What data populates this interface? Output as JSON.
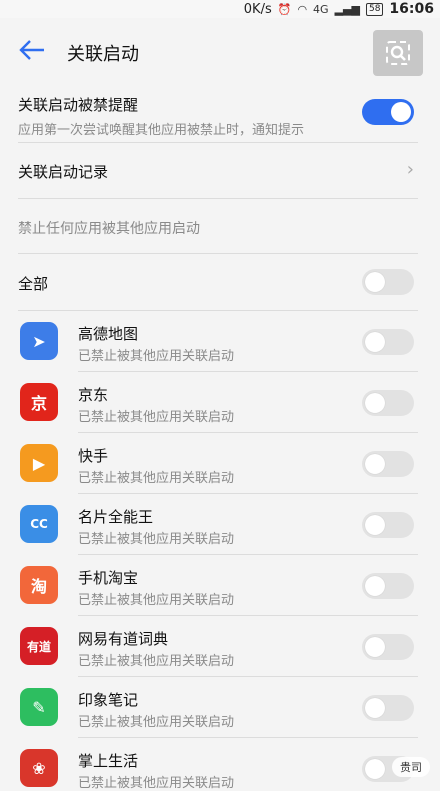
{
  "status": {
    "speed": "0K/s",
    "network": "4G",
    "battery": "58",
    "time": "16:06"
  },
  "header": {
    "title": "关联启动"
  },
  "notify": {
    "label": "关联启动被禁提醒",
    "sub": "应用第一次尝试唤醒其他应用被禁止时，通知提示",
    "on": true
  },
  "record": {
    "label": "关联启动记录"
  },
  "hint": {
    "text": "禁止任何应用被其他应用启动"
  },
  "all": {
    "label": "全部"
  },
  "apps": [
    {
      "name": "高德地图",
      "status": "已禁止被其他应用关联启动",
      "icon": "gaode-icon",
      "color": "#3d7de8",
      "glyph": "➤"
    },
    {
      "name": "京东",
      "status": "已禁止被其他应用关联启动",
      "icon": "jd-icon",
      "color": "#e1251b",
      "glyph": "京"
    },
    {
      "name": "快手",
      "status": "已禁止被其他应用关联启动",
      "icon": "kuaishou-icon",
      "color": "#f59a1f",
      "glyph": "▶"
    },
    {
      "name": "名片全能王",
      "status": "已禁止被其他应用关联启动",
      "icon": "camcard-icon",
      "color": "#3a8ee6",
      "glyph": "CC"
    },
    {
      "name": "手机淘宝",
      "status": "已禁止被其他应用关联启动",
      "icon": "taobao-icon",
      "color": "#f2673a",
      "glyph": "淘"
    },
    {
      "name": "网易有道词典",
      "status": "已禁止被其他应用关联启动",
      "icon": "youdao-icon",
      "color": "#d51f26",
      "glyph": "有道"
    },
    {
      "name": "印象笔记",
      "status": "已禁止被其他应用关联启动",
      "icon": "evernote-icon",
      "color": "#2dbe60",
      "glyph": "✎"
    },
    {
      "name": "掌上生活",
      "status": "已禁止被其他应用关联启动",
      "icon": "zhangshang-icon",
      "color": "#d9362b",
      "glyph": "❀"
    }
  ],
  "watermark": "贵司"
}
